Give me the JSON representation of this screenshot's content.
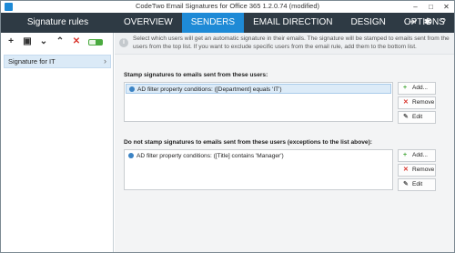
{
  "window": {
    "title": "CodeTwo Email Signatures for Office 365 1.2.0.74 (modified)",
    "min_glyph": "–",
    "max_glyph": "□",
    "close_glyph": "✕"
  },
  "header": {
    "app_title": "Signature rules",
    "tabs": [
      {
        "label": "OVERVIEW",
        "active": false
      },
      {
        "label": "SENDERS",
        "active": true
      },
      {
        "label": "EMAIL DIRECTION",
        "active": false
      },
      {
        "label": "DESIGN",
        "active": false
      },
      {
        "label": "OPTIONS",
        "active": false
      }
    ],
    "icons": [
      "sign-out-icon",
      "gear-icon",
      "help-icon"
    ],
    "icon_glyphs": {
      "signout": "⇥",
      "gear": "✱",
      "help": "?"
    }
  },
  "sidebar": {
    "toolbar": {
      "add": "+",
      "save": "▣",
      "down": "⌄",
      "up": "⌃",
      "delete": "✕",
      "toggle_state": "on"
    },
    "rules": [
      {
        "label": "Signature for IT",
        "chevron": "›",
        "selected": true
      }
    ]
  },
  "main": {
    "info_text": "Select which users will get an automatic signature in their emails. The signature will be stamped to emails sent from the users from the top list. If you want to exclude specific users from the email rule, add them to the bottom list.",
    "info_icon_glyph": "i",
    "stamp_section": {
      "label": "Stamp signatures to emails sent from these users:",
      "rows": [
        "AD filter property conditions: ([Department] equals 'IT')"
      ]
    },
    "exclude_section": {
      "label": "Do not stamp signatures to emails sent from these users (exceptions to the list above):",
      "rows": [
        "AD filter property conditions: ([Title] contains 'Manager')"
      ]
    },
    "buttons": {
      "add": "Add...",
      "remove": "Remove",
      "edit": "Edit",
      "add_glyph": "+",
      "remove_glyph": "✕",
      "edit_glyph": "✎"
    }
  },
  "colors": {
    "header_bg": "#2e3a44",
    "accent": "#1e8ad6",
    "selection": "#dcebf8"
  }
}
